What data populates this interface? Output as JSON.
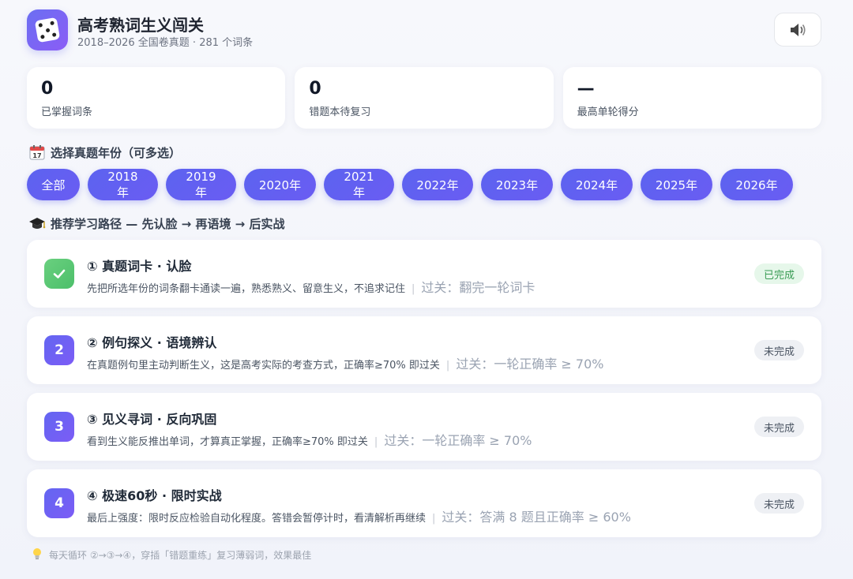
{
  "header": {
    "title": "高考熟词生义闯关",
    "subtitle": "2018–2026 全国卷真题 · 281 个词条",
    "logo_icon": "dice-icon",
    "sound_icon": "speaker-icon"
  },
  "stats": [
    {
      "value": "0",
      "label": "已掌握词条"
    },
    {
      "value": "0",
      "label": "错题本待复习"
    },
    {
      "value": "—",
      "label": "最高单轮得分"
    }
  ],
  "year_section": {
    "title": "选择真题年份（可多选）",
    "icon": "calendar-icon",
    "years": [
      "全部",
      "2018年",
      "2019年",
      "2020年",
      "2021年",
      "2022年",
      "2023年",
      "2024年",
      "2025年",
      "2026年"
    ]
  },
  "path_section": {
    "title": "推荐学习路径 — 先认脸 → 再语境 → 后实战",
    "icon": "graduation-cap-icon"
  },
  "steps": [
    {
      "num": "✓",
      "title": "① 真题词卡 · 认脸",
      "desc": "先把所选年份的词条翻卡通读一遍，熟悉熟义、留意生义，不追求记住",
      "pass": "过关：翻完一轮词卡",
      "status": "已完成",
      "done": true
    },
    {
      "num": "2",
      "title": "② 例句探义 · 语境辨认",
      "desc": "在真题例句里主动判断生义，这是高考实际的考查方式，正确率≥70% 即过关",
      "pass": "过关：一轮正确率 ≥ 70%",
      "status": "未完成",
      "done": false
    },
    {
      "num": "3",
      "title": "③ 见义寻词 · 反向巩固",
      "desc": "看到生义能反推出单词，才算真正掌握，正确率≥70% 即过关",
      "pass": "过关：一轮正确率 ≥ 70%",
      "status": "未完成",
      "done": false
    },
    {
      "num": "4",
      "title": "④ 极速60秒 · 限时实战",
      "desc": "最后上强度：限时反应检验自动化程度。答错会暂停计时，看清解析再继续",
      "pass": "过关：答满 8 题且正确率 ≥ 60%",
      "status": "未完成",
      "done": false
    }
  ],
  "tip": {
    "icon": "lightbulb-icon",
    "text": "每天循环 ②→③→④，穿插「错题重练」复习薄弱词，效果最佳"
  },
  "colors": {
    "accent": "#5c63f0",
    "done_green": "#4cbf6a"
  }
}
